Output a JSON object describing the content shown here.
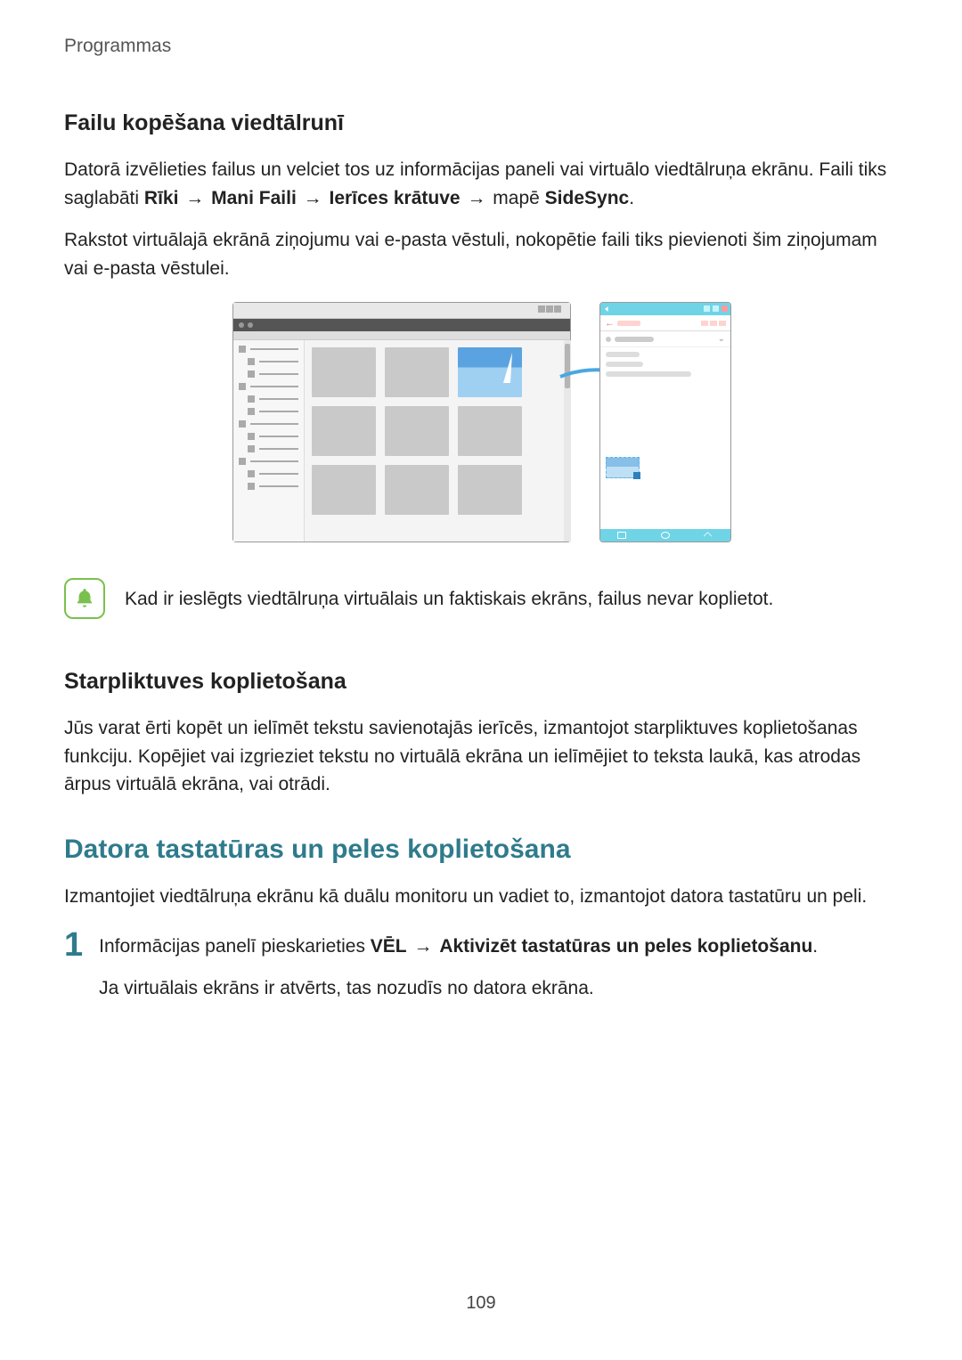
{
  "header": {
    "breadcrumb": "Programmas"
  },
  "section1": {
    "title": "Failu kopēšana viedtālrunī",
    "para1_a": "Datorā izvēlieties failus un velciet tos uz informācijas paneli vai virtuālo viedtālruņa ekrānu. Faili tiks saglabāti ",
    "path_riki": "Rīki",
    "path_faili": "Mani Faili",
    "path_kratuve": "Ierīces krātuve",
    "para1_b": " mapē ",
    "path_sidesync": "SideSync",
    "para1_end": ".",
    "para2": "Rakstot virtuālajā ekrānā ziņojumu vai e-pasta vēstuli, nokopētie faili tiks pievienoti šim ziņojumam vai e-pasta vēstulei."
  },
  "note": {
    "text": "Kad ir ieslēgts viedtālruņa virtuālais un faktiskais ekrāns, failus nevar koplietot."
  },
  "section2": {
    "title": "Starpliktuves koplietošana",
    "para": "Jūs varat ērti kopēt un ielīmēt tekstu savienotajās ierīcēs, izmantojot starpliktuves koplietošanas funkciju. Kopējiet vai izgrieziet tekstu no virtuālā ekrāna un ielīmējiet to teksta laukā, kas atrodas ārpus virtuālā ekrāna, vai otrādi."
  },
  "section3": {
    "title": "Datora tastatūras un peles koplietošana",
    "intro": "Izmantojiet viedtālruņa ekrānu kā duālu monitoru un vadiet to, izmantojot datora tastatūru un peli.",
    "step1_num": "1",
    "step1_a": "Informācijas panelī pieskarieties ",
    "step1_vel": "VĒL",
    "step1_act": "Aktivizēt tastatūras un peles koplietošanu",
    "step1_end": ".",
    "step1_p2": "Ja virtuālais ekrāns ir atvērts, tas nozudīs no datora ekrāna."
  },
  "page_number": "109",
  "arrow_char": "→"
}
